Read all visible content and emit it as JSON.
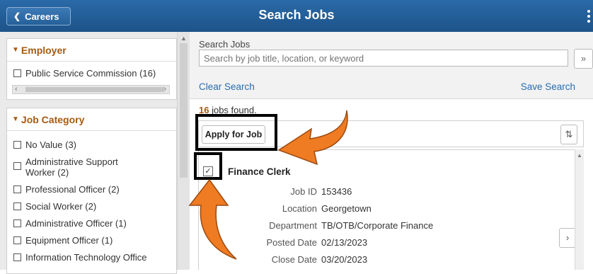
{
  "header": {
    "back_label": "Careers",
    "title": "Search Jobs"
  },
  "facets": {
    "employer": {
      "title": "Employer",
      "options": [
        {
          "label": "Public Service Commission (16)"
        }
      ]
    },
    "job_category": {
      "title": "Job Category",
      "options": [
        {
          "label": "No Value (3)"
        },
        {
          "label": "Administrative Support Worker (2)"
        },
        {
          "label": "Professional Officer (2)"
        },
        {
          "label": "Social Worker (2)"
        },
        {
          "label": "Administrative Officer (1)"
        },
        {
          "label": "Equipment Officer (1)"
        },
        {
          "label": "Information Technology Office"
        }
      ]
    }
  },
  "search": {
    "label": "Search Jobs",
    "placeholder": "Search by job title, location, or keyword",
    "go_label": "»",
    "clear_label": "Clear Search",
    "save_label": "Save Search"
  },
  "results": {
    "count": "16",
    "count_suffix": " jobs found.",
    "apply_label": "Apply for Job",
    "sort_icon": "sort-icon"
  },
  "job": {
    "checked": true,
    "title": "Finance Clerk",
    "fields": [
      {
        "label": "Job ID",
        "value": "153436"
      },
      {
        "label": "Location",
        "value": "Georgetown"
      },
      {
        "label": "Department",
        "value": "TB/OTB/Corporate Finance"
      },
      {
        "label": "Posted Date",
        "value": "02/13/2023"
      },
      {
        "label": "Close Date",
        "value": "03/20/2023"
      }
    ]
  },
  "colors": {
    "header": "#1d5389",
    "facet_title": "#a75a10",
    "link": "#2a6cad",
    "annotation_arrow": "#ef7b22"
  }
}
